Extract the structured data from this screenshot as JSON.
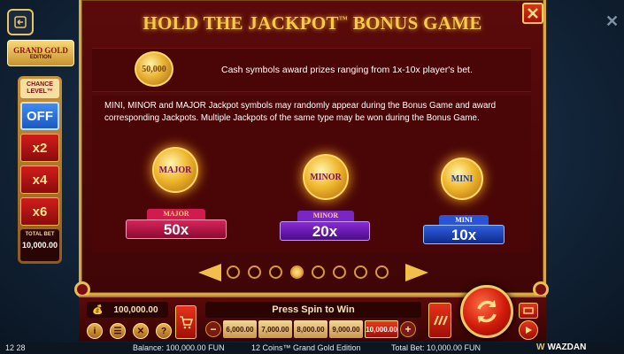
{
  "window": {
    "title": "HOLD THE JACKPOT",
    "title_tm": "™",
    "title_rest": " BONUS GAME"
  },
  "logo": {
    "line1": "GRAND GOLD",
    "line2": "EDITION"
  },
  "chance_level": {
    "title": "CHANCE LEVEL™",
    "options": [
      "OFF",
      "x2",
      "x4",
      "x6"
    ],
    "selected": "OFF",
    "total_bet_label": "TOTAL BET",
    "total_bet_value": "10,000.00"
  },
  "info": {
    "cash_coin_text": "50,000",
    "cash_text": "Cash symbols award prizes ranging from 1x-10x player's bet.",
    "jackpot_text": "MINI, MINOR and MAJOR Jackpot symbols may randomly appear during the Bonus Game and award corresponding Jackpots. Multiple Jackpots of the same type may be won during the Bonus Game.",
    "jackpots": [
      {
        "coin": "MAJOR",
        "label": "MAJOR",
        "value": "50x",
        "color": "#c0124a"
      },
      {
        "coin": "MINOR",
        "label": "MINOR",
        "value": "20x",
        "color": "#6a1ab0"
      },
      {
        "coin": "MINI",
        "label": "MINI",
        "value": "10x",
        "color": "#1b43c8"
      }
    ]
  },
  "pagination": {
    "total": 8,
    "current": 4
  },
  "bottom": {
    "balance": "100,000.00",
    "press_spin": "Press Spin to Win",
    "bets": [
      "6,000.00",
      "7,000.00",
      "8,000.00",
      "9,000.00",
      "10,000.00"
    ],
    "selected_bet": "10,000.00",
    "minus": "−",
    "plus": "+"
  },
  "status_bar": {
    "time": "12 28",
    "balance": "Balance: 100,000.00 FUN",
    "game": "12 Coins™ Grand Gold Edition",
    "total_bet": "Total Bet: 10,000.00 FUN",
    "brand": "WAZDAN"
  },
  "colors": {
    "accent_gold": "#d9a93f",
    "panel_red": "#5b0a0b",
    "title_gold": "#f6c94a"
  }
}
